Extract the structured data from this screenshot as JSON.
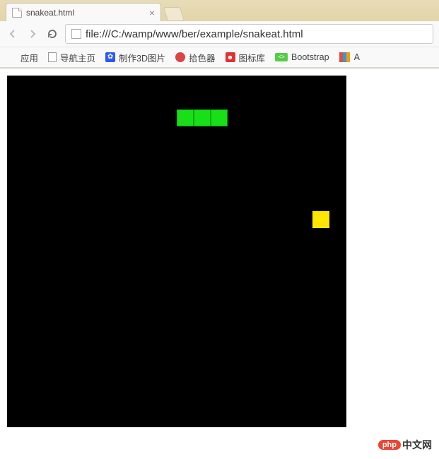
{
  "browser": {
    "tab_title": "snakeat.html",
    "url": "file:///C:/wamp/www/ber/example/snakeat.html",
    "bookmarks": [
      {
        "label": "应用",
        "icon": "apps"
      },
      {
        "label": "导航主页",
        "icon": "page"
      },
      {
        "label": "制作3D图片",
        "icon": "baidu"
      },
      {
        "label": "拾色器",
        "icon": "palette"
      },
      {
        "label": "图标库",
        "icon": "iconlib"
      },
      {
        "label": "Bootstrap",
        "icon": "bootstrap"
      },
      {
        "label": "A",
        "icon": "multi"
      }
    ]
  },
  "game": {
    "board_size_px": 480,
    "cell_size_px": 24,
    "snake_cells": [
      {
        "col": 10,
        "row": 2
      },
      {
        "col": 11,
        "row": 2
      },
      {
        "col": 12,
        "row": 2
      }
    ],
    "food_cell": {
      "col": 18,
      "row": 8
    },
    "colors": {
      "board_bg": "#000000",
      "snake": "#18df18",
      "food": "#ffe600"
    }
  },
  "watermark": {
    "badge": "php",
    "text": "中文网"
  }
}
